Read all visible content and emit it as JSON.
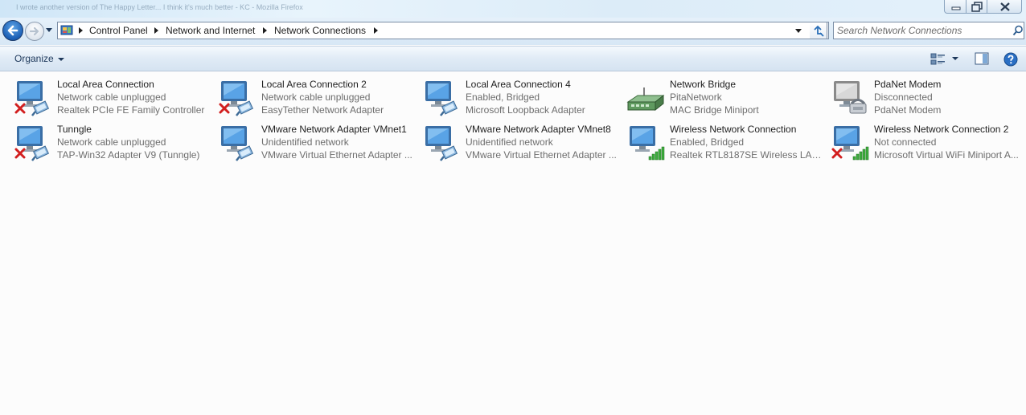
{
  "window": {
    "title_strip": "I wrote another version of The Happy Letter... I think it's much better - KC - Mozilla Firefox",
    "accent": "#1b5fb5"
  },
  "address": {
    "breadcrumbs": [
      "Control Panel",
      "Network and Internet",
      "Network Connections"
    ]
  },
  "search": {
    "placeholder": "Search Network Connections"
  },
  "toolbar": {
    "organize_label": "Organize"
  },
  "connections": [
    {
      "name": "Local Area Connection",
      "status": "Network cable unplugged",
      "device": "Realtek PCIe FE Family Controller",
      "icon": "lan-disconnected-icon"
    },
    {
      "name": "Local Area Connection 2",
      "status": "Network cable unplugged",
      "device": "EasyTether Network Adapter",
      "icon": "lan-disconnected-icon"
    },
    {
      "name": "Local Area Connection 4",
      "status": "Enabled, Bridged",
      "device": "Microsoft Loopback Adapter",
      "icon": "lan-icon"
    },
    {
      "name": "Network Bridge",
      "status": "PitaNetwork",
      "device": "MAC Bridge Miniport",
      "icon": "network-bridge-icon"
    },
    {
      "name": "PdaNet Modem",
      "status": "Disconnected",
      "device": "PdaNet Modem",
      "icon": "modem-icon"
    },
    {
      "name": "Tunngle",
      "status": "Network cable unplugged",
      "device": "TAP-Win32 Adapter V9 (Tunngle)",
      "icon": "lan-disconnected-icon"
    },
    {
      "name": "VMware Network Adapter VMnet1",
      "status": "Unidentified network",
      "device": "VMware Virtual Ethernet Adapter ...",
      "icon": "lan-icon"
    },
    {
      "name": "VMware Network Adapter VMnet8",
      "status": "Unidentified network",
      "device": "VMware Virtual Ethernet Adapter ...",
      "icon": "lan-icon"
    },
    {
      "name": "Wireless Network Connection",
      "status": "Enabled, Bridged",
      "device": "Realtek RTL8187SE Wireless LAN ...",
      "icon": "wireless-icon"
    },
    {
      "name": "Wireless Network Connection 2",
      "status": "Not connected",
      "device": "Microsoft Virtual WiFi Miniport A...",
      "icon": "wireless-disconnected-icon"
    }
  ]
}
